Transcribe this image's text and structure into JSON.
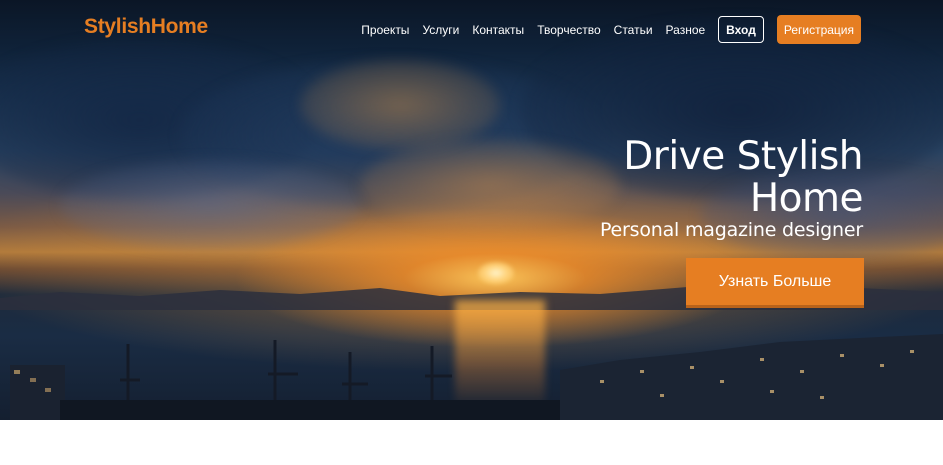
{
  "header": {
    "brand": "StylishHome",
    "nav": [
      {
        "label": "Проекты"
      },
      {
        "label": "Услуги"
      },
      {
        "label": "Контакты"
      },
      {
        "label": "Творчество"
      },
      {
        "label": "Статьи"
      },
      {
        "label": "Разное"
      }
    ],
    "login_label": "Вход",
    "register_label": "Регистрация"
  },
  "hero": {
    "title_line1": "Drive Stylish",
    "title_line2": "Home",
    "subtitle": "Personal magazine designer",
    "cta_label": "Узнать Больше"
  },
  "colors": {
    "accent": "#e67e22",
    "text_on_hero": "#ffffff",
    "background": "#ffffff"
  }
}
